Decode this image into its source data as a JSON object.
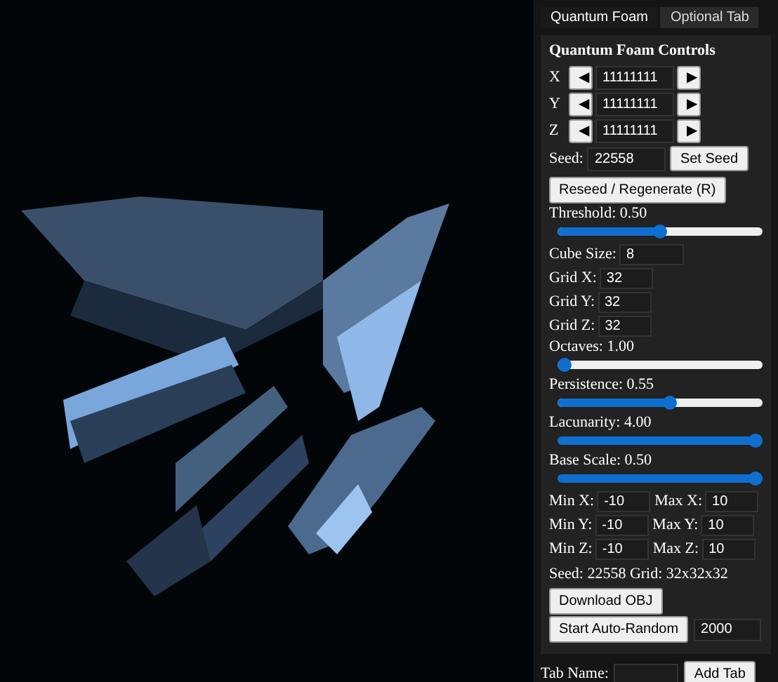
{
  "tabs": [
    {
      "label": "Quantum Foam",
      "selected": true
    },
    {
      "label": "Optional Tab",
      "selected": false
    }
  ],
  "controls": {
    "title": "Quantum Foam Controls",
    "axes": [
      {
        "label": "X",
        "left": "◀",
        "value": "11111111",
        "right": "▶"
      },
      {
        "label": "Y",
        "left": "◀",
        "value": "11111111",
        "right": "▶"
      },
      {
        "label": "Z",
        "left": "◀",
        "value": "11111111",
        "right": "▶"
      }
    ],
    "seed": {
      "label": "Seed:",
      "value": "22558",
      "button": "Set Seed"
    },
    "reseed_button": "Reseed / Regenerate (R)",
    "items": [
      {
        "kind": "slider",
        "label": "Threshold: 0.50",
        "level": 0.5
      },
      {
        "kind": "field",
        "label": "Cube Size:",
        "value": "8"
      },
      {
        "kind": "field",
        "label": "Grid X:",
        "value": "32"
      },
      {
        "kind": "field",
        "label": "Grid Y:",
        "value": "32"
      },
      {
        "kind": "field",
        "label": "Grid Z:",
        "value": "32"
      },
      {
        "kind": "slider",
        "label": "Octaves: 1.00",
        "level": 0
      },
      {
        "kind": "slider",
        "label": "Persistence: 0.55",
        "level": 0.55
      },
      {
        "kind": "slider",
        "label": "Lacunarity: 4.00",
        "level": 1
      },
      {
        "kind": "slider",
        "label": "Base Scale: 0.50",
        "level": 1
      }
    ],
    "bounds": [
      [
        {
          "label": "Min X:",
          "value": "-10"
        },
        {
          "label": "Max X:",
          "value": "10"
        }
      ],
      [
        {
          "label": "Min Y:",
          "value": "-10"
        },
        {
          "label": "Max Y:",
          "value": "10"
        }
      ],
      [
        {
          "label": "Min Z:",
          "value": "-10"
        },
        {
          "label": "Max Z:",
          "value": "10"
        }
      ]
    ],
    "status": "Seed: 22558 Grid: 32x32x32",
    "download_button": "Download OBJ",
    "auto_random": {
      "button": "Start Auto-Random",
      "value": "2000"
    }
  },
  "add_tab": {
    "label": "Tab Name:",
    "button": "Add Tab"
  }
}
